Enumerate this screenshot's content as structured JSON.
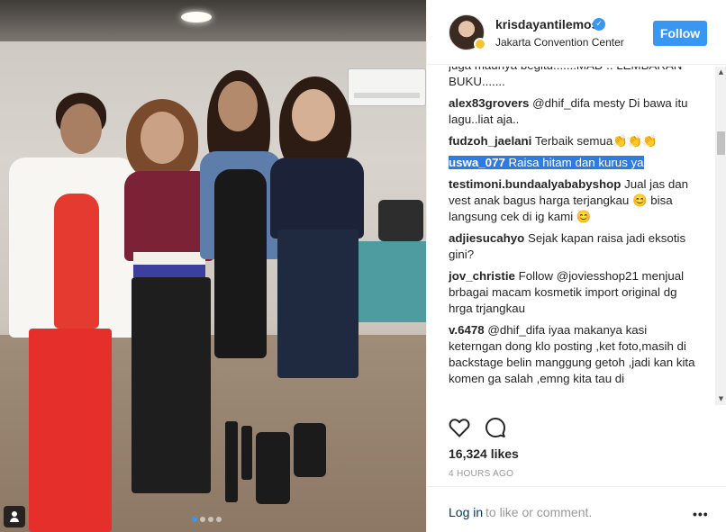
{
  "post": {
    "username": "krisdayantilemos",
    "verified": true,
    "location": "Jakarta Convention Center",
    "follow_label": "Follow",
    "likes": "16,324 likes",
    "time": "4 HOURS AGO",
    "carousel": {
      "count": 4,
      "active_index": 0
    }
  },
  "comments": [
    {
      "user": "",
      "text": "juga maunya begitu.......MAD .. LEMBARAN BUKU......."
    },
    {
      "user": "alex83grovers",
      "text": "@dhif_difa mesty Di bawa itu lagu..liat aja.."
    },
    {
      "user": "fudzoh_jaelani",
      "text": "Terbaik semua👏👏👏"
    },
    {
      "user": "uswa_077",
      "text": "Raisa hitam dan kurus ya"
    },
    {
      "user": "testimoni.bundaalyababyshop",
      "text": "Jual jas dan vest anak bagus harga terjangkau 😊 bisa langsung cek di ig kami 😊"
    },
    {
      "user": "adjiesucahyo",
      "text": "Sejak kapan raisa jadi eksotis gini?"
    },
    {
      "user": "jov_christie",
      "text": "Follow @joviesshop21 menjual brbagai macam kosmetik import original dg hrga trjangkau"
    },
    {
      "user": "v.6478",
      "text": "@dhif_difa iyaa makanya kasi keterngan dong klo posting ,ket foto,masih di backstage belin manggung getoh ,jadi kan kita komen ga salah ,emng kita tau di"
    }
  ],
  "footer": {
    "login_link": "Log in",
    "login_rest": "to like or comment.",
    "more_label": "•••"
  },
  "icons": {
    "like": "heart-outline-icon",
    "comment": "speech-bubble-icon",
    "verified": "verified-badge-icon",
    "more": "more-options-icon",
    "tagged_user": "user-tag-icon"
  },
  "colors": {
    "accent": "#3897f0",
    "link": "#003569",
    "highlight": "#2f7be0",
    "muted": "#999999"
  }
}
